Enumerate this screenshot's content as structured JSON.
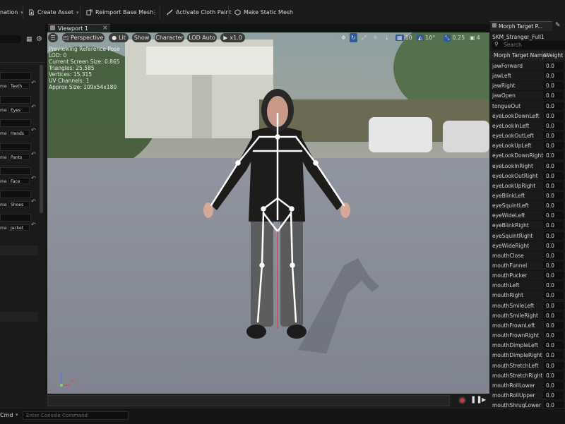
{
  "toolbar": {
    "animation_label": "nation",
    "create_asset_label": "Create Asset",
    "reimport_label": "Reimport Base Mesh",
    "cloth_paint_label": "Activate Cloth Paint",
    "make_static_label": "Make Static Mesh"
  },
  "left_panel": {
    "name_prefix": "me",
    "slots": [
      "Teeth",
      "Eyes",
      "Hands",
      "Pants",
      "Face",
      "Shoes",
      "Jacket"
    ]
  },
  "viewport": {
    "tab_title": "Viewport 1",
    "buttons": {
      "perspective": "Perspective",
      "lit": "Lit",
      "show": "Show",
      "character": "Character",
      "lod": "LOD Auto",
      "play_speed": "x1.0"
    },
    "grid_value": "10",
    "angle_value": "10°",
    "scale_value": "0.25",
    "camera_speed": "4",
    "stats": [
      "Previewing Reference Pose",
      "LOD: 0",
      "Current Screen Size: 0.865",
      "Triangles: 25,585",
      "Vertices: 15,315",
      "UV Channels: 1",
      "Approx Size: 109x54x180"
    ],
    "axis": {
      "x": "X",
      "z": "Z"
    },
    "colors": {
      "floor": "#8d929c",
      "sky": "#9aa2a3"
    }
  },
  "morph_panel": {
    "tab_title": "Morph Target P...",
    "asset_name": "SKM_Stranger_Full1",
    "search_placeholder": "Search",
    "col_name": "Morph Target Name",
    "col_weight": "Weight",
    "targets": [
      {
        "name": "jawForward",
        "weight": "0.0"
      },
      {
        "name": "jawLeft",
        "weight": "0.0"
      },
      {
        "name": "jawRight",
        "weight": "0.0"
      },
      {
        "name": "jawOpen",
        "weight": "0.0"
      },
      {
        "name": "tongueOut",
        "weight": "0.0"
      },
      {
        "name": "eyeLookDownLeft",
        "weight": "0.0"
      },
      {
        "name": "eyeLookInLeft",
        "weight": "0.0"
      },
      {
        "name": "eyeLookOutLeft",
        "weight": "0.0"
      },
      {
        "name": "eyeLookUpLeft",
        "weight": "0.0"
      },
      {
        "name": "eyeLookDownRight",
        "weight": "0.0"
      },
      {
        "name": "eyeLookInRight",
        "weight": "0.0"
      },
      {
        "name": "eyeLookOutRight",
        "weight": "0.0"
      },
      {
        "name": "eyeLookUpRight",
        "weight": "0.0"
      },
      {
        "name": "eyeBlinkLeft",
        "weight": "0.0"
      },
      {
        "name": "eyeSquintLeft",
        "weight": "0.0"
      },
      {
        "name": "eyeWideLeft",
        "weight": "0.0"
      },
      {
        "name": "eyeBlinkRight",
        "weight": "0.0"
      },
      {
        "name": "eyeSquintRight",
        "weight": "0.0"
      },
      {
        "name": "eyeWideRight",
        "weight": "0.0"
      },
      {
        "name": "mouthClose",
        "weight": "0.0"
      },
      {
        "name": "mouthFunnel",
        "weight": "0.0"
      },
      {
        "name": "mouthPucker",
        "weight": "0.0"
      },
      {
        "name": "mouthLeft",
        "weight": "0.0"
      },
      {
        "name": "mouthRight",
        "weight": "0.0"
      },
      {
        "name": "mouthSmileLeft",
        "weight": "0.0"
      },
      {
        "name": "mouthSmileRight",
        "weight": "0.0"
      },
      {
        "name": "mouthFrownLeft",
        "weight": "0.0"
      },
      {
        "name": "mouthFrownRight",
        "weight": "0.0"
      },
      {
        "name": "mouthDimpleLeft",
        "weight": "0.0"
      },
      {
        "name": "mouthDimpleRight",
        "weight": "0.0"
      },
      {
        "name": "mouthStretchLeft",
        "weight": "0.0"
      },
      {
        "name": "mouthStretchRight",
        "weight": "0.0"
      },
      {
        "name": "mouthRollLower",
        "weight": "0.0"
      },
      {
        "name": "mouthRollUpper",
        "weight": "0.0"
      },
      {
        "name": "mouthShrugLower",
        "weight": "0.0"
      }
    ]
  },
  "console": {
    "cmd_label": "Cmd",
    "placeholder": "Enter Console Command"
  },
  "icons": [
    "save-icon",
    "reimport-icon",
    "paint-brush-icon",
    "static-mesh-icon",
    "hamburger-menu-icon",
    "perspective-icon",
    "lit-icon",
    "play-icon",
    "pause-icon",
    "record-icon",
    "search-icon",
    "reset-arrow-icon",
    "close-icon",
    "gear-icon",
    "table-icon"
  ]
}
